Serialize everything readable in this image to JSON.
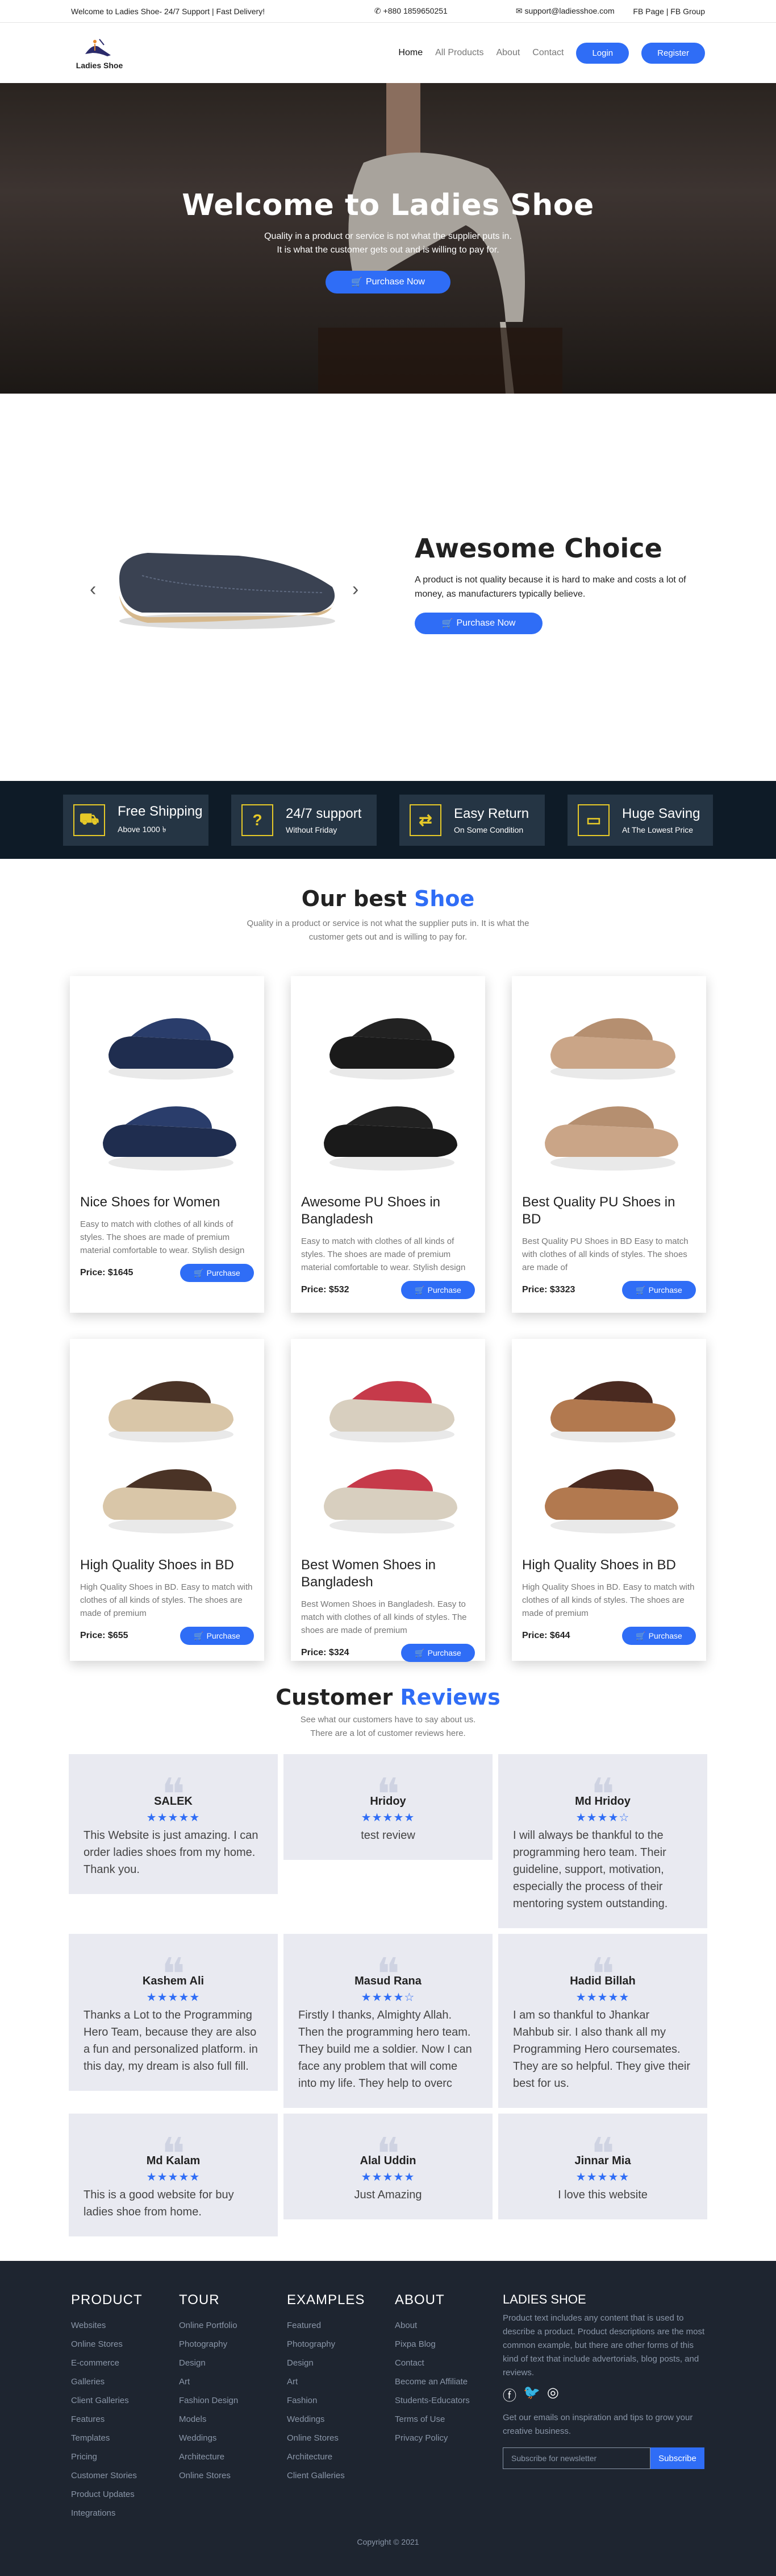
{
  "topbar": {
    "welcome": "Welcome to Ladies Shoe- 24/7 Support | Fast Delivery!",
    "phone": "+880 1859650251",
    "email": "support@ladiesshoe.com",
    "fb": "FB Page | FB Group"
  },
  "nav": {
    "logo": "Ladies Shoe",
    "items": [
      "Home",
      "All Products",
      "About",
      "Contact"
    ],
    "login": "Login",
    "register": "Register"
  },
  "hero": {
    "title": "Welcome to Ladies Shoe",
    "text": "Quality in a product or service is not what the supplier puts in. It is what the customer gets out and is willing to pay for.",
    "button": "Purchase Now"
  },
  "carousel": {
    "title": "Awesome Choice",
    "text": "A product is not quality because it is hard to make and costs a lot of money, as manufacturers typically believe.",
    "button": "Purchase Now"
  },
  "features": [
    {
      "title": "Free Shipping",
      "sub": "Above 1000 ৳",
      "icon": "truck-icon"
    },
    {
      "title": "24/7 support",
      "sub": "Without Friday",
      "icon": "question-icon"
    },
    {
      "title": "Easy Return",
      "sub": "On Some Condition",
      "icon": "exchange-icon"
    },
    {
      "title": "Huge Saving",
      "sub": "At The Lowest Price",
      "icon": "card-icon"
    }
  ],
  "products_section": {
    "title_a": "Our best ",
    "title_b": "Shoe",
    "sub": "Quality in a product or service is not what the supplier puts in. It is what the customer gets out and is willing to pay for."
  },
  "products": [
    {
      "name": "Nice Shoes for Women",
      "desc": "Easy to match with clothes of all kinds of styles. The shoes are made of premium material comfortable to wear. Stylish design",
      "price": "Price: $1645",
      "btn": "Purchase",
      "color": "#1f2d4f",
      "strap": "#2a3d6b"
    },
    {
      "name": "Awesome PU Shoes in Bangladesh",
      "desc": "Easy to match with clothes of all kinds of styles. The shoes are made of premium material comfortable to wear. Stylish design",
      "price": "Price: $532",
      "btn": "Purchase",
      "color": "#1a1a1a",
      "strap": "#222"
    },
    {
      "name": "Best Quality PU Shoes in BD",
      "desc": "Best Quality PU Shoes in BD Easy to match with clothes of all kinds of styles. The shoes are made of",
      "price": "Price: $3323",
      "btn": "Purchase",
      "color": "#caa587",
      "strap": "#b58f70"
    },
    {
      "name": "High Quality Shoes in BD",
      "desc": "High Quality Shoes in BD. Easy to match with clothes of all kinds of styles. The shoes are made of premium",
      "price": "Price: $655",
      "btn": "Purchase",
      "color": "#d9c6a8",
      "strap": "#4a3326"
    },
    {
      "name": "Best Women Shoes in Bangladesh",
      "desc": "Best Women Shoes in Bangladesh. Easy to match with clothes of all kinds of styles. The shoes are made of premium",
      "price": "Price: $324",
      "btn": "Purchase",
      "color": "#d8cfbf",
      "strap": "#c63a4a"
    },
    {
      "name": "High Quality Shoes in BD",
      "desc": "High Quality Shoes in BD. Easy to match with clothes of all kinds of styles. The shoes are made of premium",
      "price": "Price: $644",
      "btn": "Purchase",
      "color": "#b2794f",
      "strap": "#4a2a20"
    }
  ],
  "reviews_section": {
    "title_a": "Customer ",
    "title_b": "Reviews",
    "sub1": "See what our customers have to say about us.",
    "sub2": "There are a lot of customer reviews here."
  },
  "reviews": [
    {
      "name": "SALEK",
      "stars": "★★★★★",
      "text": "This Website is just amazing. I can order ladies shoes from my home. Thank you.",
      "align": "left"
    },
    {
      "name": "Hridoy",
      "stars": "★★★★★",
      "text": "test review",
      "align": "center"
    },
    {
      "name": "Md Hridoy",
      "stars": "★★★★☆",
      "text": "I will always be thankful to the programming hero team. Their guideline, support, motivation, especially the process of their mentoring system outstanding.",
      "align": "left"
    },
    {
      "name": "Kashem Ali",
      "stars": "★★★★★",
      "text": "Thanks a Lot to the Programming Hero Team, because they are also a fun and personalized platform. in this day, my dream is also full fill.",
      "align": "left"
    },
    {
      "name": "Masud Rana",
      "stars": "★★★★☆",
      "text": "Firstly I thanks, Almighty Allah. Then the programming hero team. They build me a soldier. Now I can face any problem that will come into my life. They help to overc",
      "align": "left"
    },
    {
      "name": "Hadid Billah",
      "stars": "★★★★★",
      "text": "I am so thankful to Jhankar Mahbub sir. I also thank all my Programming Hero coursemates. They are so helpful. They give their best for us.",
      "align": "left"
    },
    {
      "name": "Md Kalam",
      "stars": "★★★★★",
      "text": "This is a good website for buy ladies shoe from home.",
      "align": "left"
    },
    {
      "name": "Alal Uddin",
      "stars": "★★★★★",
      "text": "Just Amazing",
      "align": "center"
    },
    {
      "name": "Jinnar Mia",
      "stars": "★★★★★",
      "text": "I love this website",
      "align": "center"
    }
  ],
  "footer": {
    "cols": [
      {
        "title": "PRODUCT",
        "links": [
          "Websites",
          "Online Stores",
          "E-commerce",
          "Galleries",
          "Client Galleries",
          "Features",
          "Templates",
          "Pricing",
          "Customer Stories",
          "Product Updates",
          "Integrations"
        ]
      },
      {
        "title": "TOUR",
        "links": [
          "Online Portfolio",
          "Photography",
          "Design",
          "Art",
          "Fashion Design",
          "Models",
          "Weddings",
          "Architecture",
          "Online Stores"
        ]
      },
      {
        "title": "EXAMPLES",
        "links": [
          "Featured",
          "Photography",
          "Design",
          "Art",
          "Fashion",
          "Weddings",
          "Online Stores",
          "Architecture",
          "Client Galleries"
        ]
      },
      {
        "title": "ABOUT",
        "links": [
          "About",
          "Pixpa Blog",
          "Contact",
          "Become an Affiliate",
          "Students-Educators",
          "Terms of Use",
          "Privacy Policy"
        ]
      }
    ],
    "brand_title": "LADIES SHOE",
    "brand_text": "Product text includes any content that is used to describe a product. Product descriptions are the most common example, but there are other forms of this kind of text that include advertorials, blog posts, and reviews.",
    "newsletter_text": "Get our emails on inspiration and tips to grow your creative business.",
    "placeholder": "Subscribe for newsletter",
    "subscribe": "Subscribe",
    "copyright": "Copyright © 2021"
  }
}
